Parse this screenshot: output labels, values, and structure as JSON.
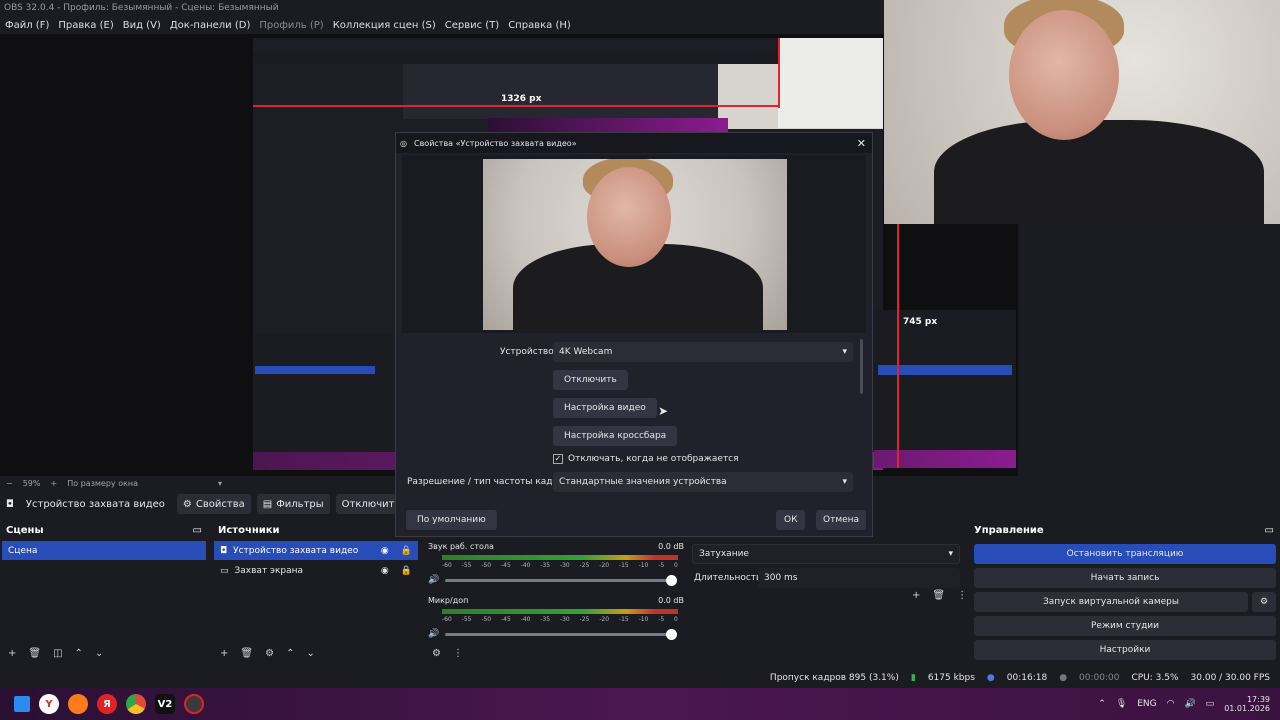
{
  "app": {
    "title": "OBS 32.0.4 - Профиль: Безымянный - Сцены: Безымянный"
  },
  "menu": [
    "Файл (F)",
    "Правка (E)",
    "Вид (V)",
    "Док-панели (D)",
    "Профиль (P)",
    "Коллекция сцен (S)",
    "Сервис (T)",
    "Справка (H)"
  ],
  "preview": {
    "width_label": "1326 px",
    "height_label": "745 px"
  },
  "zoom": {
    "level": "59%",
    "mode": "По размеру окна"
  },
  "source_toolbar": {
    "name": "Устройство захвата видео",
    "properties": "Свойства",
    "filters": "Фильтры",
    "deactivate": "Отключить"
  },
  "scenes": {
    "title": "Сцены",
    "items": [
      "Сцена"
    ]
  },
  "sources": {
    "title": "Источники",
    "items": [
      "Устройство захвата видео",
      "Захват экрана"
    ]
  },
  "mixer": {
    "channels": [
      {
        "name": "Звук раб. стола",
        "db": "0.0 dB"
      },
      {
        "name": "Микр/доп",
        "db": "0.0 dB"
      }
    ],
    "ticks": [
      "-60",
      "-55",
      "-50",
      "-45",
      "-40",
      "-35",
      "-30",
      "-25",
      "-20",
      "-15",
      "-10",
      "-5",
      "0"
    ]
  },
  "transitions": {
    "type": "Затухание",
    "duration_label": "Длительность",
    "duration": "300 ms"
  },
  "controls": {
    "title": "Управление",
    "stop_stream": "Остановить трансляцию",
    "start_record": "Начать запись",
    "virtual_cam": "Запуск виртуальной камеры",
    "studio_mode": "Режим студии",
    "settings": "Настройки"
  },
  "dialog": {
    "title": "Свойства «Устройство захвата видео»",
    "device_label": "Устройство",
    "device_value": "4K Webcam",
    "deactivate": "Отключить",
    "configure_video": "Настройка видео",
    "configure_crossbar": "Настройка кроссбара",
    "deactivate_hidden": "Отключать, когда не отображается",
    "resolution_label": "Разрешение / тип частоты кадров",
    "resolution_value": "Стандартные значения устройства",
    "defaults": "По умолчанию",
    "ok": "ОК",
    "cancel": "Отмена"
  },
  "status": {
    "dropped": "Пропуск кадров 895 (3.1%)",
    "bitrate": "6175 kbps",
    "stream_time": "00:16:18",
    "rec_time": "00:00:00",
    "cpu": "CPU: 3.5%",
    "fps": "30.00 / 30.00 FPS"
  },
  "taskbar": {
    "lang": "ENG",
    "time": "17:39",
    "date": "01.01.2026"
  },
  "colors": {
    "accent": "#284cb8",
    "record_red": "#e0232c",
    "taskbar": "#4b1750"
  }
}
